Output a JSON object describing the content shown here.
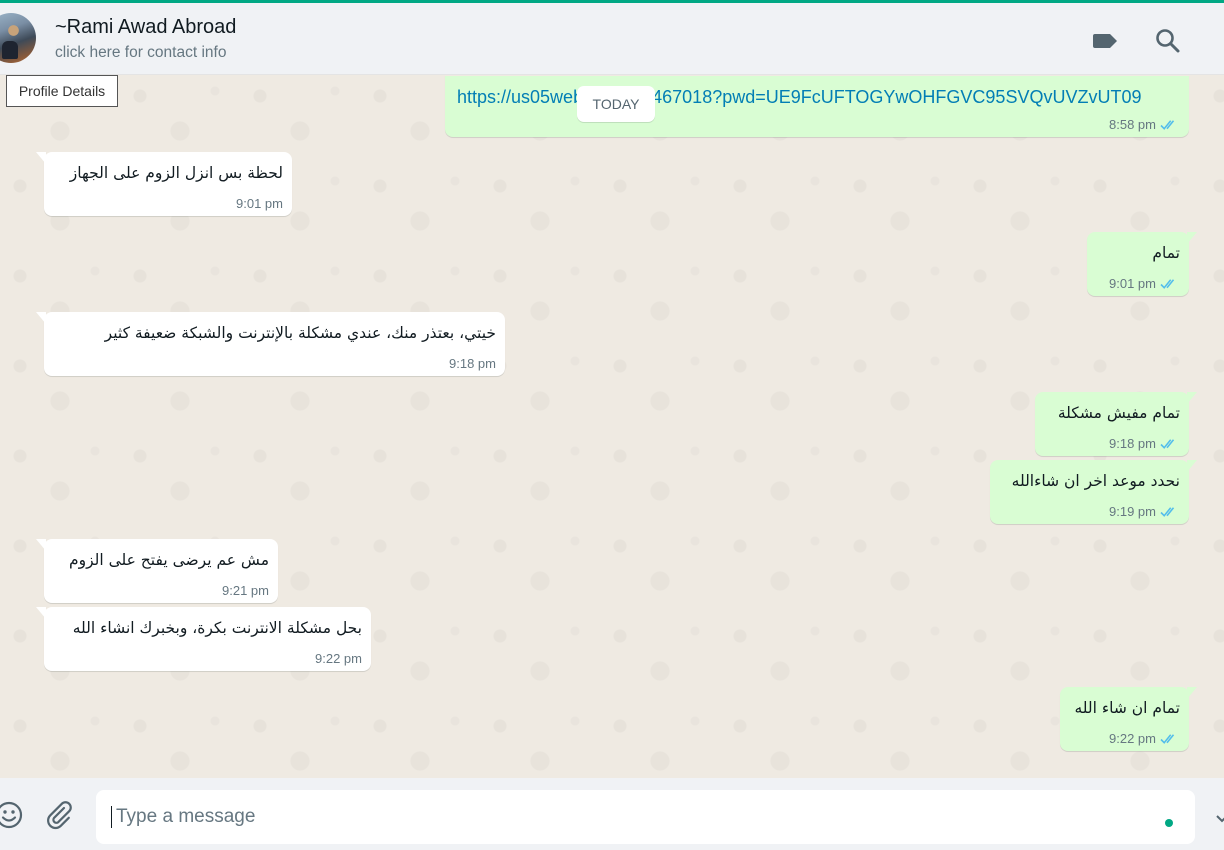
{
  "header": {
    "contact_name": "~Rami Awad Abroad",
    "contact_subtitle": "click here for contact info",
    "icons": [
      "label-icon",
      "search-icon"
    ]
  },
  "tooltip": {
    "text": "Profile Details"
  },
  "date_divider": "TODAY",
  "messages": [
    {
      "direction": "out",
      "text": "https://us05web.zoom.us/j/84247467018?pwd=UE9FcUFTOGYwOHFGVC95SVQvUVZvUT09",
      "visible_text": "https://us05web         /j/84247467018?pwd=UE9FcUFTOGYwOHFGVC95SVQvUVZvUT09",
      "time": "8:58 pm",
      "status": "read"
    },
    {
      "direction": "in",
      "text": "لحظة بس انزل الزوم على الجهاز",
      "time": "9:01 pm"
    },
    {
      "direction": "out",
      "text": "تمام",
      "time": "9:01 pm",
      "status": "read"
    },
    {
      "direction": "in",
      "text": "خيتي، بعتذر منك، عندي مشكلة بالإنترنت والشبكة ضعيفة كثير",
      "time": "9:18 pm"
    },
    {
      "direction": "out",
      "text": "تمام مفيش مشكلة",
      "time": "9:18 pm",
      "status": "read"
    },
    {
      "direction": "out",
      "text": "نحدد موعد اخر ان شاءالله",
      "time": "9:19 pm",
      "status": "read"
    },
    {
      "direction": "in",
      "text": "مش عم يرضى يفتح على الزوم",
      "time": "9:21 pm"
    },
    {
      "direction": "in",
      "text": "بحل مشكلة الانترنت بكرة، وبخبرك انشاء الله",
      "time": "9:22 pm"
    },
    {
      "direction": "out",
      "text": "تمام ان شاء الله",
      "time": "9:22 pm",
      "status": "read"
    }
  ],
  "composer": {
    "placeholder": "Type a message",
    "value": "",
    "icons": [
      "emoji-icon",
      "attach-icon"
    ]
  },
  "colors": {
    "accent": "#00a884",
    "outgoing_bubble": "#d9fdd3",
    "incoming_bubble": "#ffffff",
    "chat_background": "#efeae2",
    "read_ticks": "#53bdeb",
    "link": "#027eb5"
  }
}
